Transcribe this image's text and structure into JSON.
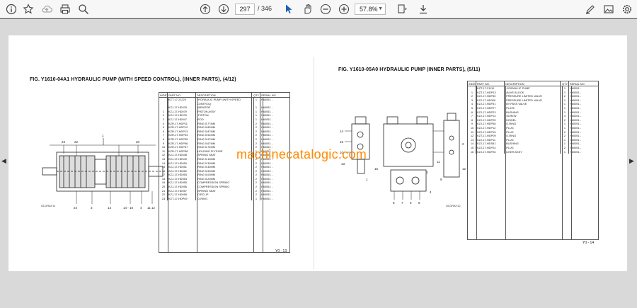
{
  "toolbar": {
    "page_current": "297",
    "page_total": "/ 346",
    "zoom": "57.8%"
  },
  "left_page": {
    "title": "FIG. Y1610-04A1    HYDRAULIC PUMP (WITH SPEED CONTROL), (INNER PARTS), (4/12)",
    "headers": [
      "INDEX",
      "PART NO.",
      "DESCRIPTION",
      "QTY",
      "SERIAL NO."
    ],
    "rows": [
      [
        "",
        "KZT-17-21220",
        "HYDRAULIC PUMP, (WITH SPEED",
        "1",
        "H60051 -"
      ],
      [
        "",
        "",
        "CONTROL)",
        "",
        ""
      ],
      [
        "",
        "KZJ-17-HD078",
        "VARIATOR",
        "1",
        "H60051 -"
      ],
      [
        "1",
        "KZJ-17-HD079",
        ".PISTON ASSY",
        "1",
        "H60051 -"
      ],
      [
        "2",
        "KZJ-17-HD076",
        "..PISTON",
        "1",
        "H60051 -"
      ],
      [
        "3",
        "KZJ-17-HD047",
        ".ROD",
        "1",
        "H60051 -"
      ],
      [
        "4",
        "KZR-17-HDP11",
        ".RING 5.77MM",
        "2",
        "H60051 -"
      ],
      [
        "5",
        "KZR-17-HDP12",
        ".RING 5.82MM",
        "2",
        "H60051 -"
      ],
      [
        "6",
        "KZR-17-HDP13",
        ".RING 5.87MM",
        "2",
        "H60051 -"
      ],
      [
        "7",
        "KZR-17-HDP54",
        ".RING 5.92MM",
        "2",
        "H60051 -"
      ],
      [
        "8",
        "KZR-17-HDP55",
        ".RING 5.97MM",
        "2",
        "H60051 -"
      ],
      [
        "9",
        "KZR-17-HDP56",
        ".RING 5.67MM",
        "2",
        "H60051 -"
      ],
      [
        "10",
        "KZR-17-HDP57",
        ".RING 5.72MM",
        "2",
        "H60051 -"
      ],
      [
        "11",
        "KZR-17-HDP58",
        ".HOLDING FIXTURE",
        "1",
        "H60051 -"
      ],
      [
        "12",
        "KZJ-17-HD048",
        ".SPRING SEAT",
        "2",
        "H60051 -"
      ],
      [
        "13",
        "KZJ-17-HD049",
        ".RING 5.13MM",
        "2",
        "H60051 -"
      ],
      [
        "14",
        "KZJ-17-HD050",
        ".RING 5.30MM",
        "2",
        "H60051 -"
      ],
      [
        "15",
        "KZJ-17-HD051",
        ".RING 5.40MM",
        "2",
        "H60051 -"
      ],
      [
        "16",
        "KZJ-17-HD052",
        ".RING 5.50MM",
        "2",
        "H60051 -"
      ],
      [
        "17",
        "KZJ-17-HD053",
        ".RING 5.00MM",
        "2",
        "H60051 -"
      ],
      [
        "18",
        "KZJ-17-HD054",
        ".RING 5.20MM",
        "2",
        "H60051 -"
      ],
      [
        "19",
        "KZJ-17-HD055",
        ".COMPRESSION SPRING",
        "2",
        "H60051 -"
      ],
      [
        "20",
        "KZJ-17-HD056",
        ".COMPRESSION SPRING",
        "2",
        "H60051 -"
      ],
      [
        "21",
        "KZJ-17-HD057",
        ".SPRING SEAT",
        "2",
        "H60051 -"
      ],
      [
        "22",
        "KZJ-17-HD058",
        ".CIRCLIP",
        "2",
        "H60051 -"
      ],
      [
        "23",
        "KZT-17-HDP09",
        ".O-RING",
        "1",
        "H60051 -"
      ]
    ],
    "page_number": "Y0 -  13",
    "diagram_code": "GLDRAY11",
    "callouts": [
      "23",
      "22",
      "1",
      "20",
      "24",
      "3",
      "13",
      "14 - 16",
      "4",
      "11",
      "12"
    ]
  },
  "right_page": {
    "title": "FIG. Y1610-05A0    HYDRAULIC PUMP (INNER PARTS), (5/11)",
    "headers": [
      "INDEX",
      "PART NO.",
      "DESCRIPTION",
      "QTY",
      "SERIAL NO."
    ],
    "rows": [
      [
        "",
        "KZT-17-21110",
        "HYDRAULIC PUMP",
        "1",
        "H60051 -"
      ],
      [
        "1",
        "KZT-17-HDP13",
        "VALVE BLOCK",
        "1",
        "H60051 -"
      ],
      [
        "2",
        "KZJ-17-HDP30",
        ".PRESSURE LIMITED VALVE",
        "2",
        "H60051 -"
      ],
      [
        "3",
        "KZJ-17-HD059",
        ".PRESSURE LIMITED VALVE",
        "1",
        "H60051 -"
      ],
      [
        "4",
        "KZJ-17-HDP31",
        ".BY-PASS VALVE",
        "1",
        "H60051 -"
      ],
      [
        "5",
        "KZJ-17-HDP27",
        ".PLATE",
        "1",
        "H60051 -"
      ],
      [
        "6",
        "KZJ-17-HDP23",
        ".BUSHING",
        "1",
        "H60051 -"
      ],
      [
        "7",
        "KZJ-17-HDP14",
        ".SCREW",
        "4",
        "H60051 -"
      ],
      [
        "8",
        "KZJ-17-HDP25",
        ".DOWEL",
        "2",
        "H60051 -"
      ],
      [
        "9",
        "KZJ-17-HDP08",
        ".O-RING",
        "1",
        "H60051 -"
      ],
      [
        "10",
        "KZJ-17-HDP12",
        ".PLUG",
        "1",
        "H60051 -"
      ],
      [
        "11",
        "KZJ-17-HDP15",
        ".PLUG",
        "2",
        "H60051 -"
      ],
      [
        "12",
        "KZT-17-HDP09",
        ".O-RING",
        "2",
        "H60051 -"
      ],
      [
        "13",
        "KZJ-17-HDP11",
        ".PLUG",
        "1",
        "H60051 -"
      ],
      [
        "14",
        "KZJ-17-HDS61",
        ".BUSHING",
        "1",
        "H60051 -"
      ],
      [
        "15",
        "KZJ-17-HDP24",
        ".PLUG",
        "2",
        "H60051 -"
      ],
      [
        "16",
        "KZJ-17-HDP26",
        ".LINER ASSY",
        "1",
        "H60051 -"
      ]
    ],
    "page_number": "Y0 -  14",
    "diagram_code": "GLDRAY12",
    "callouts": [
      "14",
      "15",
      "10",
      "13",
      "9",
      "1",
      "11",
      "16",
      "12",
      "2",
      "8",
      "7",
      "5",
      "6",
      "4",
      "3"
    ]
  },
  "watermark": "machinecatalogic.com"
}
